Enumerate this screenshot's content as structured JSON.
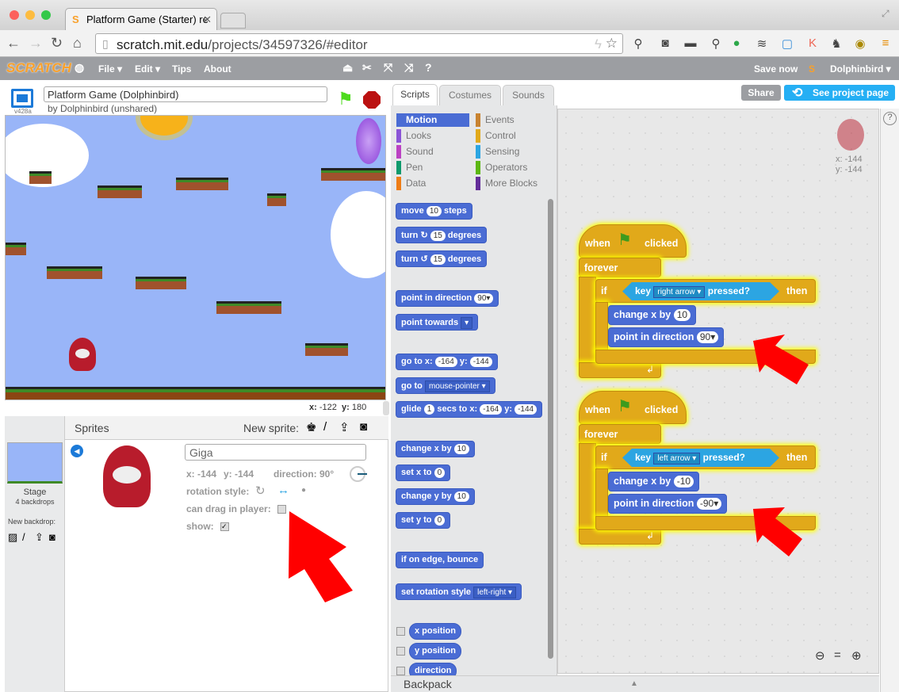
{
  "browser": {
    "tab_title": "Platform Game (Starter) re",
    "url_host": "scratch.mit.edu",
    "url_path": "/projects/34597326/#editor"
  },
  "menu": {
    "logo": "SCRATCH",
    "file": "File ▾",
    "edit": "Edit ▾",
    "tips": "Tips",
    "about": "About",
    "save_now": "Save now",
    "user": "Dolphinbird ▾"
  },
  "stage": {
    "version": "v428a",
    "project_title": "Platform Game (Dolphinbird)",
    "byline": "by Dolphinbird (unshared)",
    "mouse_x_label": "x:",
    "mouse_x": "-122",
    "mouse_y_label": "y:",
    "mouse_y": "180"
  },
  "sprites": {
    "header": "Sprites",
    "new_sprite": "New sprite:",
    "stage_label": "Stage",
    "backdrops": "4 backdrops",
    "new_backdrop": "New backdrop:",
    "name": "Giga",
    "x": "x: -144",
    "y": "y: -144",
    "direction": "direction: 90°",
    "rotation_style": "rotation style:",
    "can_drag": "can drag in player:",
    "can_drag_checked": false,
    "show": "show:",
    "show_checked": true
  },
  "tabs": [
    "Scripts",
    "Costumes",
    "Sounds"
  ],
  "buttons": {
    "share": "Share",
    "see_project": "See project page"
  },
  "categories": [
    {
      "label": "Motion",
      "color": "#4a6cd4"
    },
    {
      "label": "Events",
      "color": "#c88330"
    },
    {
      "label": "Looks",
      "color": "#8a55d7"
    },
    {
      "label": "Control",
      "color": "#e1a91a"
    },
    {
      "label": "Sound",
      "color": "#bb42c3"
    },
    {
      "label": "Sensing",
      "color": "#2ca5e2"
    },
    {
      "label": "Pen",
      "color": "#0e9a6c"
    },
    {
      "label": "Operators",
      "color": "#5cb712"
    },
    {
      "label": "Data",
      "color": "#ee7d16"
    },
    {
      "label": "More Blocks",
      "color": "#632d99"
    }
  ],
  "palette_blocks": {
    "move": "move",
    "move_val": "10",
    "steps": "steps",
    "turn": "turn",
    "turn_val": "15",
    "degrees": "degrees",
    "point_dir": "point in direction",
    "point_dir_val": "90▾",
    "point_towards": "point towards",
    "goto_xy": "go to x:",
    "goto_x": "-164",
    "y": "y:",
    "goto_y": "-144",
    "goto": "go to",
    "goto_val": "mouse-pointer ▾",
    "glide": "glide",
    "glide_val": "1",
    "glide_mid": "secs to x:",
    "glide_x": "-164",
    "glide_y": "-144",
    "change_x": "change x by",
    "change_x_val": "10",
    "set_x": "set x to",
    "set_x_val": "0",
    "change_y": "change y by",
    "change_y_val": "10",
    "set_y": "set y to",
    "set_y_val": "0",
    "bounce": "if on edge, bounce",
    "rot_style": "set rotation style",
    "rot_style_val": "left-right ▾",
    "rep_x": "x position",
    "rep_y": "y position",
    "rep_dir": "direction"
  },
  "scripts": [
    {
      "hat_when": "when",
      "hat_clicked": "clicked",
      "forever": "forever",
      "if": "if",
      "key": "key",
      "key_val": "right arrow ▾",
      "pressed": "pressed?",
      "then": "then",
      "change": "change x by",
      "change_val": "10",
      "point": "point in direction",
      "point_val": "90▾"
    },
    {
      "hat_when": "when",
      "hat_clicked": "clicked",
      "forever": "forever",
      "if": "if",
      "key": "key",
      "key_val": "left arrow ▾",
      "pressed": "pressed?",
      "then": "then",
      "change": "change x by",
      "change_val": "-10",
      "point": "point in direction",
      "point_val": "-90▾"
    }
  ],
  "sprite_corner": {
    "x": "x: -144",
    "y": "y: -144"
  },
  "backpack": "Backpack",
  "colors": {
    "motion": "#4a6cd4",
    "control": "#e1a91a",
    "sensing": "#2ca5e2",
    "arrow": "#ff0000"
  }
}
